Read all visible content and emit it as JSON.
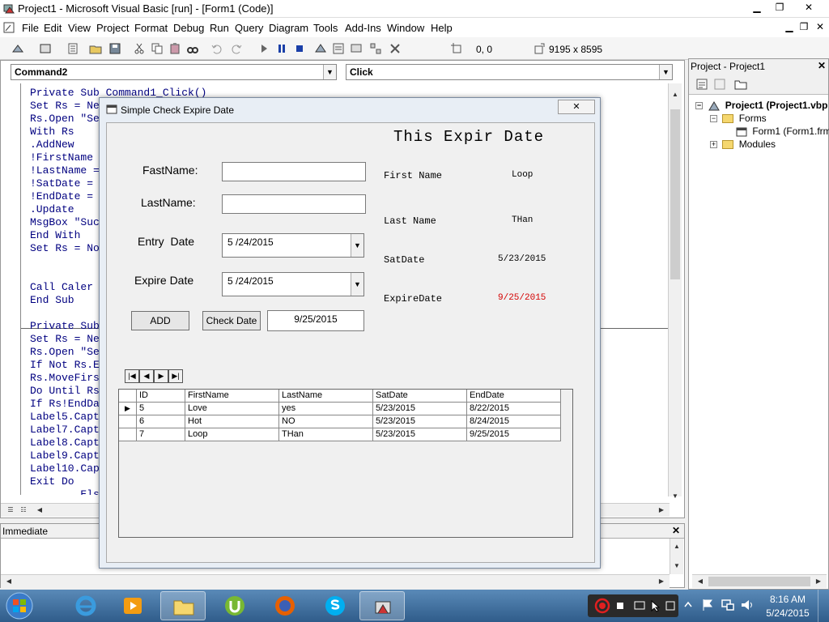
{
  "window": {
    "title": "Project1 - Microsoft Visual Basic [run] - [Form1 (Code)]"
  },
  "menu": [
    "File",
    "Edit",
    "View",
    "Project",
    "Format",
    "Debug",
    "Run",
    "Query",
    "Diagram",
    "Tools",
    "Add-Ins",
    "Window",
    "Help"
  ],
  "toolbar": {
    "position": "0, 0",
    "size": "9195 x 8595"
  },
  "code": {
    "object_combo": "Command2",
    "proc_combo": "Click",
    "lines_top": [
      "Private Sub Command1_Click()",
      "Set Rs = Ne",
      "Rs.Open \"Se",
      "With Rs",
      ".AddNew",
      "!FirstName",
      "!LastName =",
      "!SatDate =",
      "!EndDate =",
      ".Update",
      "MsgBox \"Suc",
      "End With",
      "Set Rs = No",
      "",
      "",
      "Call Caler",
      "End Sub"
    ],
    "lines_bottom": [
      "Private Sub",
      "Set Rs = Ne",
      "Rs.Open \"Se",
      "If Not Rs.E",
      "Rs.MoveFirs",
      "Do Until Rs",
      "If Rs!EndDa",
      "Label5.Capt",
      "Label7.Capt",
      "Label8.Capt",
      "Label9.Capt",
      "Label10.Cap",
      "Exit Do",
      "        Els"
    ]
  },
  "immediate": {
    "title": "Immediate"
  },
  "project": {
    "title": "Project - Project1",
    "root": "Project1 (Project1.vbp",
    "forms": "Forms",
    "form1": "Form1 (Form1.frm)",
    "modules": "Modules"
  },
  "form": {
    "caption": "Simple Check Expire Date",
    "heading": "This Expir Date",
    "labels": {
      "fastname": "FastName:",
      "lastname": "LastName:",
      "entry_date": "Entry  Date",
      "expire_date": "Expire Date"
    },
    "inputs": {
      "fastname": "",
      "lastname": "",
      "entry_date": "5 /24/2015",
      "expire_date": "5 /24/2015",
      "result": "9/25/2015"
    },
    "buttons": {
      "add": "ADD",
      "check": "Check Date"
    },
    "info": {
      "first_name_label": "First Name",
      "first_name_value": "Loop",
      "last_name_label": "Last Name",
      "last_name_value": "THan",
      "sat_label": "SatDate",
      "sat_value": "5/23/2015",
      "expire_label": "ExpireDate",
      "expire_value": "9/25/2015",
      "expire_color": "#d40000"
    },
    "grid": {
      "columns": [
        "ID",
        "FirstName",
        "LastName",
        "SatDate",
        "EndDate"
      ],
      "rows": [
        [
          "5",
          "Love",
          "yes",
          "5/23/2015",
          "8/22/2015"
        ],
        [
          "6",
          "Hot",
          "NO",
          "5/23/2015",
          "8/24/2015"
        ],
        [
          "7",
          "Loop",
          "THan",
          "5/23/2015",
          "9/25/2015"
        ]
      ]
    }
  },
  "taskbar": {
    "time": "8:16 AM",
    "date": "5/24/2015"
  }
}
